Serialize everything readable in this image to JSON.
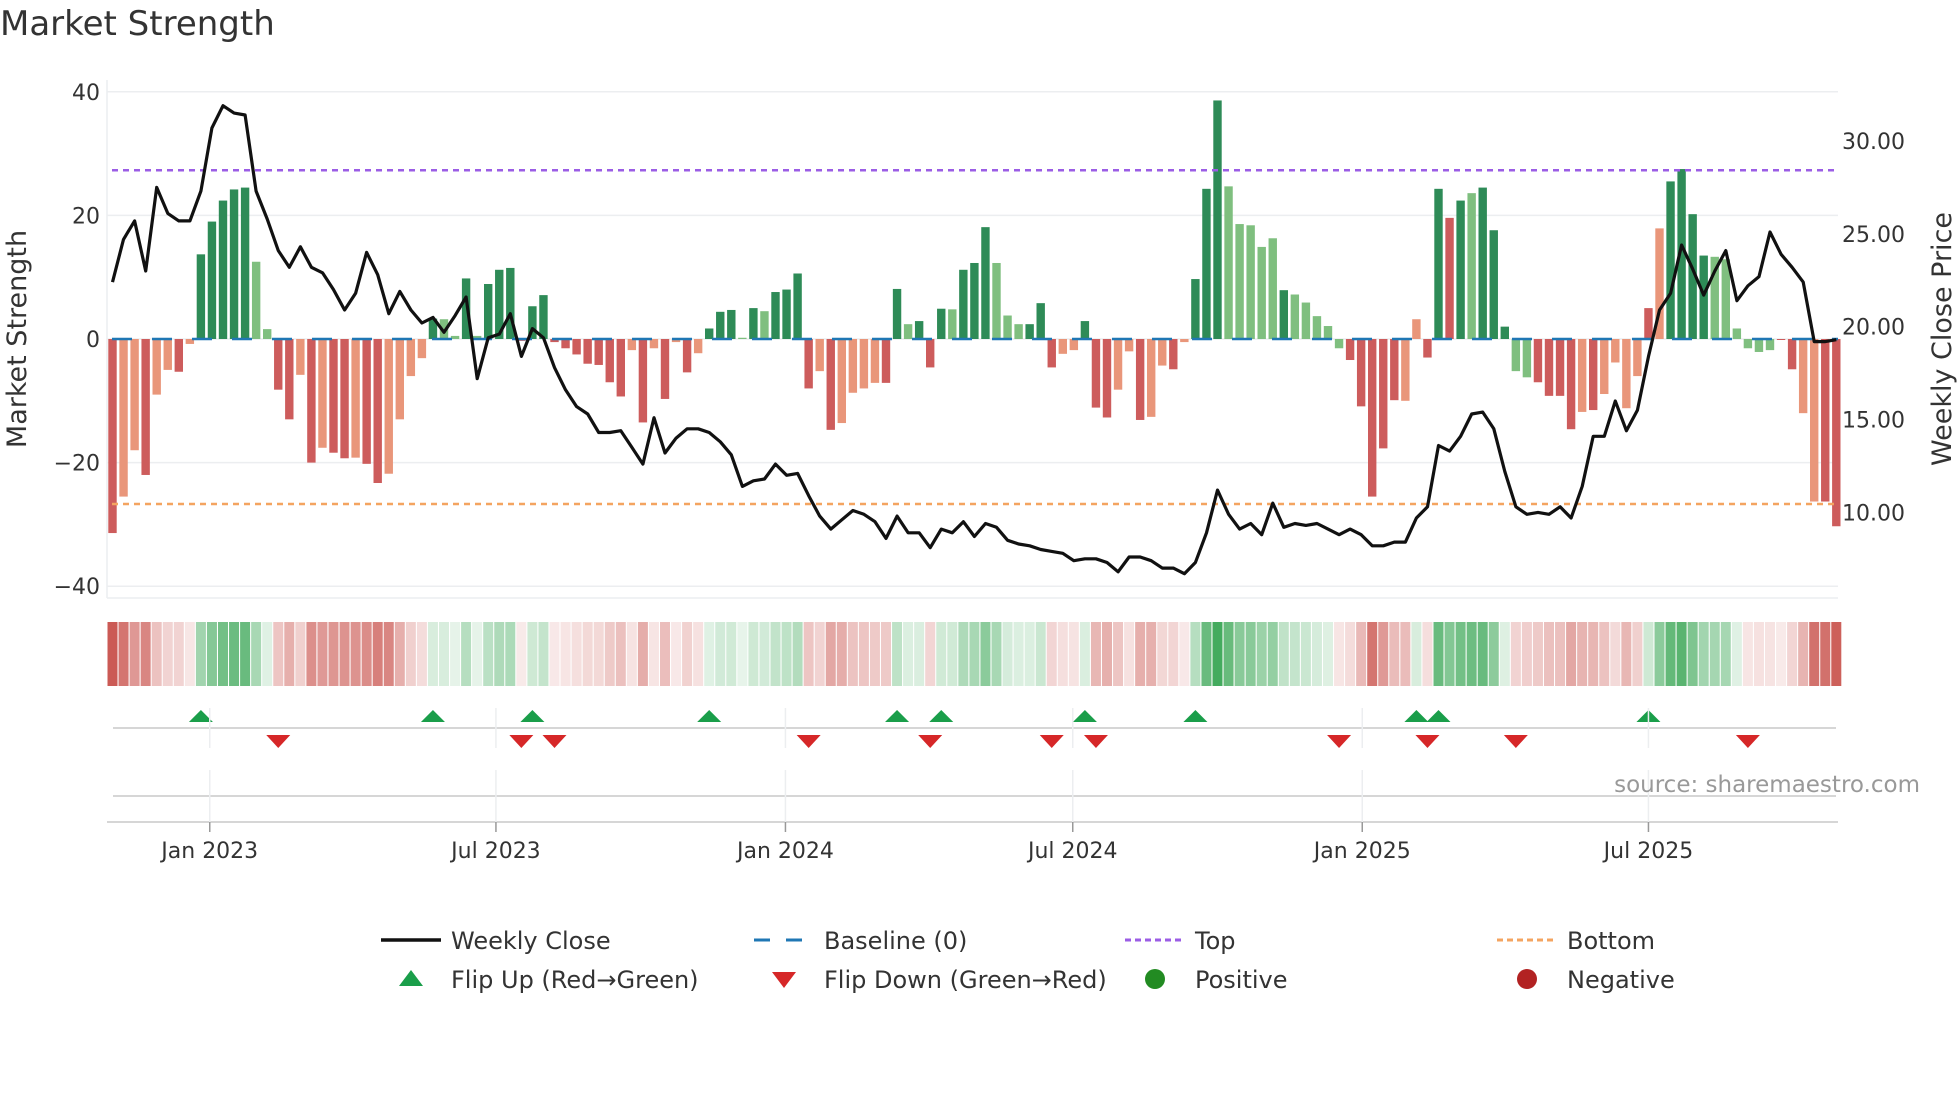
{
  "chart_data": {
    "type": "bar",
    "title": "Market Strength",
    "ylabel": "Market Strength",
    "y2label": "Weekly Close Price",
    "ylim": [
      -42,
      42
    ],
    "y2lim": [
      5.8,
      33.5
    ],
    "yticks": [
      40,
      20,
      0,
      -20,
      -40
    ],
    "ytick_labels": [
      "40",
      "20",
      "0",
      "−20",
      "−40"
    ],
    "y2ticks": [
      30,
      25,
      20,
      15,
      10
    ],
    "y2tick_labels": [
      "30.00",
      "25.00",
      "20.00",
      "15.00",
      "10.00"
    ],
    "xticks": [
      {
        "index": 8.8,
        "label": "Jan 2023"
      },
      {
        "index": 34.7,
        "label": "Jul 2023"
      },
      {
        "index": 60.9,
        "label": "Jan 2024"
      },
      {
        "index": 86.9,
        "label": "Jul 2024"
      },
      {
        "index": 113.1,
        "label": "Jan 2025"
      },
      {
        "index": 139.0,
        "label": "Jul 2025"
      }
    ],
    "top_level": 27.3,
    "bottom_level": -26.7,
    "baseline": 0,
    "strength_values": [
      -31.4,
      -25.5,
      -18,
      -22,
      -9,
      -5,
      -5.3,
      -0.8,
      13.7,
      19,
      22.4,
      24.2,
      24.5,
      12.5,
      1.6,
      -8.2,
      -13,
      -5.8,
      -20,
      -17.6,
      -18.4,
      -19.3,
      -19.2,
      -20.2,
      -23.3,
      -21.8,
      -13,
      -6,
      -3.1,
      3.3,
      3.2,
      0.5,
      9.8,
      0.5,
      8.9,
      11.2,
      11.5,
      -0.3,
      5.3,
      7.1,
      -0.5,
      -1.5,
      -2.5,
      -4,
      -4.2,
      -7,
      -9.3,
      -1.8,
      -13.5,
      -1.5,
      -9.7,
      -0.5,
      -5.4,
      -2.3,
      1.7,
      4.4,
      4.7,
      0.2,
      5.0,
      4.5,
      7.6,
      8.0,
      10.6,
      -8.0,
      -5.2,
      -14.7,
      -13.6,
      -8.7,
      -8.0,
      -7.1,
      -7.1,
      8.1,
      2.4,
      2.9,
      -4.6,
      4.9,
      4.8,
      11.2,
      12.3,
      18.1,
      12.3,
      3.8,
      2.4,
      2.4,
      5.8,
      -4.6,
      -2.4,
      -1.8,
      2.9,
      -11.1,
      -12.7,
      -8.2,
      -2.0,
      -13.1,
      -12.6,
      -4.3,
      -4.9,
      -0.5,
      9.7,
      24.3,
      38.6,
      24.7,
      18.6,
      18.4,
      14.9,
      16.3,
      7.9,
      7.2,
      5.9,
      3.7,
      2.1,
      -1.5,
      -3.4,
      -10.9,
      -25.5,
      -17.7,
      -9.9,
      -10,
      3.2,
      -3.0,
      24.3,
      19.6,
      22.4,
      23.6,
      24.5,
      17.6,
      2.0,
      -5.2,
      -6.2,
      -7.0,
      -9.2,
      -9.2,
      -14.6,
      -11.8,
      -11.5,
      -8.9,
      -3.8,
      -11.2,
      -6.0,
      5.0,
      17.9,
      25.5,
      27.5,
      20.2,
      13.5,
      13.3,
      12.9,
      1.7,
      -1.5,
      -2.1,
      -1.8,
      -0.1,
      -4.9,
      -12,
      -26.3,
      -26.3,
      -30.3
    ],
    "strength_shades": "RrrRrrRrGGGGGggRRrRrRRrRRrrrrGggGgGGGRGGRRRRRRRrRrRrRrGGGgGgGGGRrRrrrrRGgGRGgGGGgggGGRrrGRRrrRrrRrGGGgggggGgggggRRRRRrrRGRGgGGGggRRRRrRrrrrRrGGGGggggggRRrrRRRrR",
    "weekly_close": [
      22.4,
      24.7,
      25.7,
      23.0,
      27.5,
      26.1,
      25.7,
      25.7,
      27.3,
      30.7,
      31.9,
      31.5,
      31.4,
      27.3,
      25.8,
      24.1,
      23.2,
      24.3,
      23.2,
      22.9,
      22.0,
      20.9,
      21.8,
      24.0,
      22.8,
      20.7,
      21.9,
      20.9,
      20.2,
      20.5,
      19.7,
      20.6,
      21.6,
      17.2,
      19.4,
      19.6,
      20.7,
      18.4,
      19.9,
      19.4,
      17.8,
      16.6,
      15.7,
      15.3,
      14.3,
      14.3,
      14.4,
      13.5,
      12.6,
      15.1,
      13.2,
      14.0,
      14.5,
      14.5,
      14.3,
      13.8,
      13.1,
      11.4,
      11.7,
      11.8,
      12.6,
      12.0,
      12.1,
      10.9,
      9.8,
      9.1,
      9.6,
      10.1,
      9.9,
      9.5,
      8.6,
      9.8,
      8.9,
      8.9,
      8.1,
      9.1,
      8.9,
      9.5,
      8.7,
      9.4,
      9.2,
      8.5,
      8.3,
      8.2,
      8.0,
      7.9,
      7.8,
      7.4,
      7.5,
      7.5,
      7.3,
      6.8,
      7.6,
      7.6,
      7.4,
      7.0,
      7.0,
      6.7,
      7.3,
      8.9,
      11.2,
      9.9,
      9.1,
      9.4,
      8.8,
      10.5,
      9.2,
      9.4,
      9.3,
      9.4,
      9.1,
      8.8,
      9.1,
      8.8,
      8.2,
      8.2,
      8.4,
      8.4,
      9.7,
      10.3,
      13.6,
      13.3,
      14.1,
      15.3,
      15.4,
      14.5,
      12.2,
      10.3,
      9.9,
      10.0,
      9.9,
      10.3,
      9.7,
      11.4,
      14.1,
      14.1,
      16.0,
      14.4,
      15.5,
      18.4,
      20.9,
      21.8,
      24.4,
      23.1,
      21.7,
      23.0,
      24.1,
      21.4,
      22.2,
      22.7,
      25.1,
      23.9,
      23.2,
      22.4,
      19.2,
      19.2,
      19.3
    ],
    "flip_up_indices": [
      8,
      29,
      38,
      54,
      71,
      75,
      88,
      98,
      118,
      120,
      139
    ],
    "flip_down_indices": [
      15,
      37,
      40,
      63,
      74,
      85,
      89,
      111,
      119,
      127,
      148
    ],
    "legend": [
      {
        "label": "Weekly Close",
        "icon": "solid-line"
      },
      {
        "label": "Baseline (0)",
        "icon": "dashed-line"
      },
      {
        "label": "Top",
        "icon": "dotted-line"
      },
      {
        "label": "Bottom",
        "icon": "dotted-line"
      },
      {
        "label": "Flip Up (Red→Green)",
        "icon": "triangle-up"
      },
      {
        "label": "Flip Down (Green→Red)",
        "icon": "triangle-down"
      },
      {
        "label": "Positive",
        "icon": "circle"
      },
      {
        "label": "Negative",
        "icon": "circle"
      }
    ],
    "legend_placement": "bottom-center",
    "source": "source: sharemaestro.com",
    "colors": {
      "strong_positive": "#2e8b57",
      "weak_positive": "#7fbf7f",
      "strong_negative": "#cd5c5c",
      "weak_negative": "#e9967a",
      "weekly_close": "#111111",
      "baseline": "#1f77b4",
      "top": "#9b5de5",
      "bottom": "#f4a460",
      "flip_up": "#1a9e4a",
      "flip_down": "#d62728",
      "positive": "#228b22",
      "negative": "#b22222"
    }
  }
}
